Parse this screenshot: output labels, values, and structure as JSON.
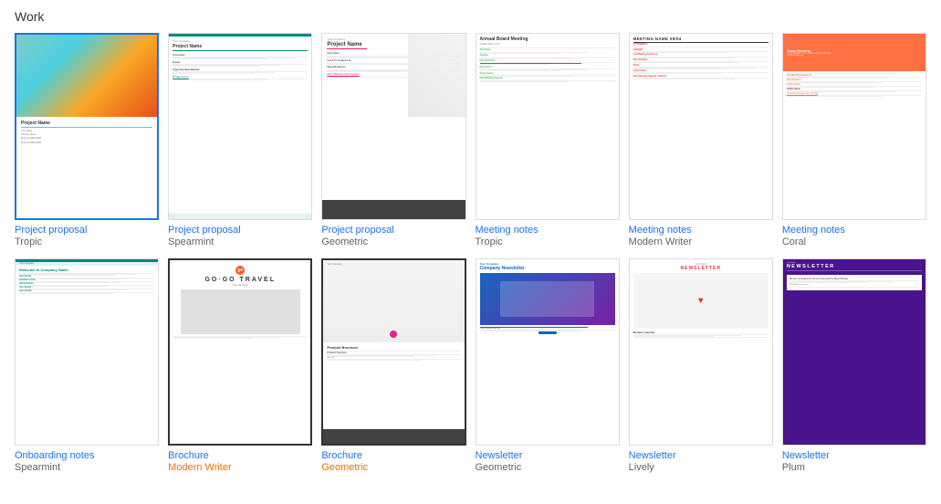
{
  "section": {
    "title": "Work"
  },
  "templates": [
    {
      "id": "project-proposal-tropic",
      "name": "Project proposal",
      "sub": "Tropic",
      "sub_color": "blue",
      "selected": true,
      "outlined": false,
      "type": "tropic-proposal"
    },
    {
      "id": "project-proposal-spearmint",
      "name": "Project proposal",
      "sub": "Spearmint",
      "sub_color": "blue",
      "selected": false,
      "outlined": false,
      "type": "spearmint-proposal"
    },
    {
      "id": "project-proposal-geometric",
      "name": "Project proposal",
      "sub": "Geometric",
      "sub_color": "blue",
      "selected": false,
      "outlined": false,
      "type": "geometric-proposal"
    },
    {
      "id": "meeting-notes-tropic",
      "name": "Meeting notes",
      "sub": "Tropic",
      "sub_color": "blue",
      "selected": false,
      "outlined": false,
      "type": "meeting-tropic"
    },
    {
      "id": "meeting-notes-modern-writer",
      "name": "Meeting notes",
      "sub": "Modern Writer",
      "sub_color": "blue",
      "selected": false,
      "outlined": false,
      "type": "meeting-modern"
    },
    {
      "id": "meeting-notes-coral",
      "name": "Meeting notes",
      "sub": "Coral",
      "sub_color": "blue",
      "selected": false,
      "outlined": false,
      "type": "meeting-coral"
    },
    {
      "id": "onboarding-notes-spearmint",
      "name": "Onboarding notes",
      "sub": "Spearmint",
      "sub_color": "blue",
      "selected": false,
      "outlined": false,
      "type": "onboarding-spearmint"
    },
    {
      "id": "brochure-modern-writer",
      "name": "Brochure",
      "sub": "Modern Writer",
      "sub_color": "orange",
      "selected": false,
      "outlined": true,
      "type": "brochure-mw"
    },
    {
      "id": "brochure-geometric",
      "name": "Brochure",
      "sub": "Geometric",
      "sub_color": "orange",
      "selected": false,
      "outlined": true,
      "type": "brochure-geo"
    },
    {
      "id": "newsletter-geometric",
      "name": "Newsletter",
      "sub": "Geometric",
      "sub_color": "blue",
      "selected": false,
      "outlined": false,
      "type": "newsletter-geo"
    },
    {
      "id": "newsletter-lively",
      "name": "Newsletter",
      "sub": "Lively",
      "sub_color": "blue",
      "selected": false,
      "outlined": false,
      "type": "newsletter-lively"
    },
    {
      "id": "newsletter-plum",
      "name": "Newsletter",
      "sub": "Plum",
      "sub_color": "blue",
      "selected": false,
      "outlined": false,
      "type": "newsletter-plum"
    }
  ]
}
